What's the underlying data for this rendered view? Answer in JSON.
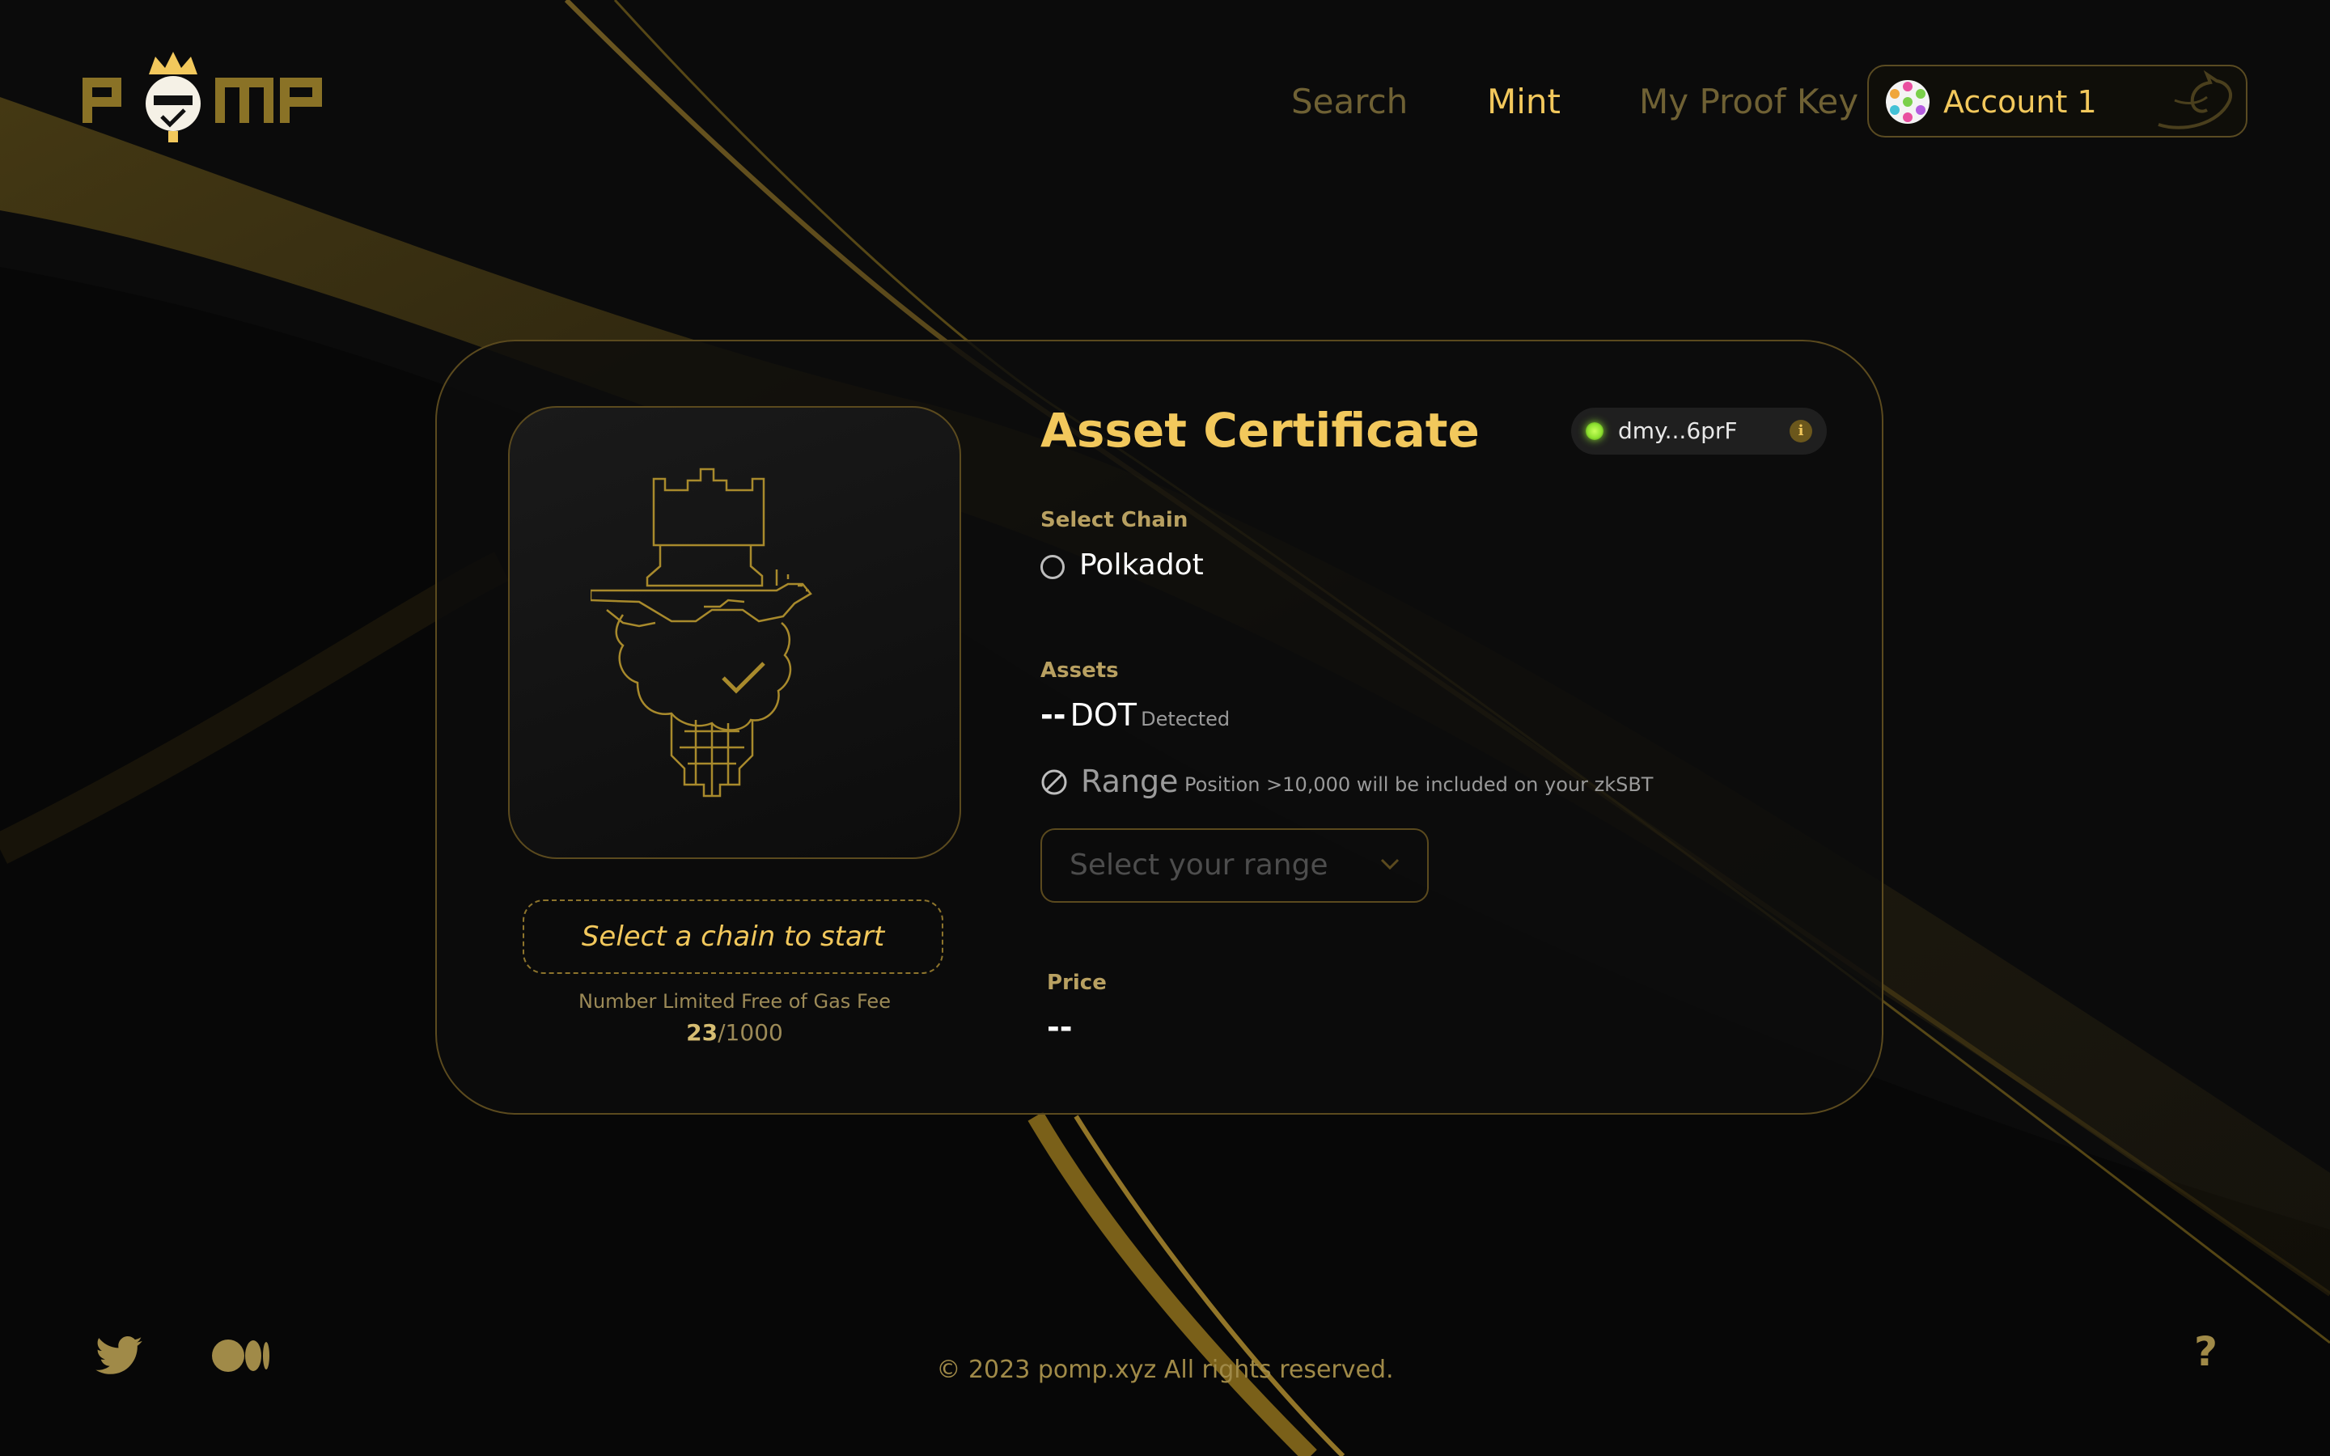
{
  "brand": {
    "logo_text": "POMP"
  },
  "nav": {
    "items": [
      {
        "label": "Search",
        "active": false
      },
      {
        "label": "Mint",
        "active": true
      },
      {
        "label": "My Proof Key",
        "active": false
      }
    ],
    "account_label": "Account 1"
  },
  "card": {
    "title": "Asset Certificate",
    "address": "dmy...6prF",
    "info_icon": "i",
    "start_button": "Select a chain to start",
    "limit_label": "Number Limited Free of Gas Fee",
    "limit_current": "23",
    "limit_total": "/1000",
    "select_chain_label": "Select Chain",
    "chain_option": "Polkadot",
    "assets_label": "Assets",
    "assets_amount": "--",
    "assets_unit": "DOT",
    "assets_status": "Detected",
    "range_label": "Range",
    "range_note": "Position >10,000 will be included on your zkSBT",
    "range_placeholder": "Select your range",
    "price_label": "Price",
    "price_value": "--"
  },
  "footer": {
    "copyright": "© 2023 pomp.xyz All rights reserved.",
    "help": "?"
  },
  "colors": {
    "accent": "#f2c85c",
    "muted_gold": "#6f6134",
    "border_gold": "#5b4a1e",
    "background": "#0a0a0a",
    "status_green": "#8ee130"
  }
}
